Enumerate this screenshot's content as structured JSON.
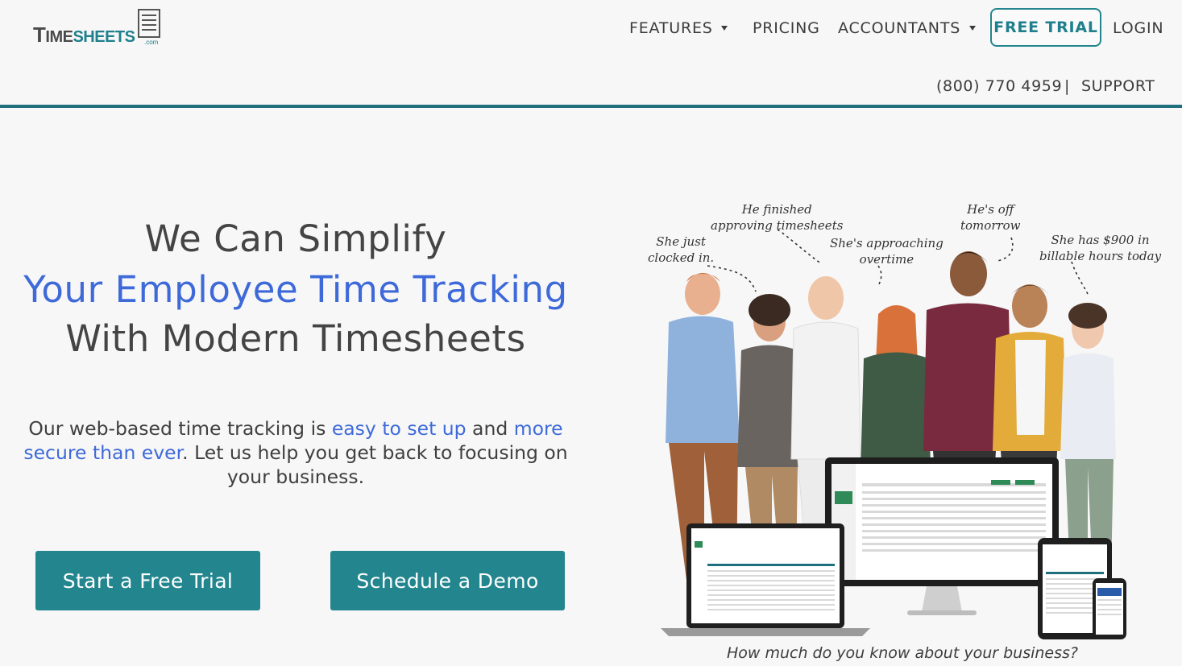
{
  "header": {
    "logo": {
      "text_main": "TIMESHEETS",
      "text_suffix": ".com"
    },
    "nav": {
      "features": "FEATURES",
      "pricing": "PRICING",
      "accountants": "ACCOUNTANTS",
      "free_trial": "FREE TRIAL",
      "login": "LOGIN"
    },
    "phone": "(800) 770 4959",
    "separator": "|",
    "support": "SUPPORT"
  },
  "hero": {
    "headline_1": "We Can Simplify",
    "headline_2": "Your Employee Time Tracking",
    "headline_3": "With Modern Timesheets",
    "blurb": {
      "part1": "Our web-based time tracking is ",
      "highlight1": "easy to set up",
      "part2": " and ",
      "highlight2": "more secure than ever",
      "part3": ". Let us help you get back to focusing on your business."
    },
    "cta_primary": "Start a Free Trial",
    "cta_secondary": "Schedule a Demo"
  },
  "illustration": {
    "notes": {
      "clocked_in": "She just\nclocked in.",
      "approving": "He finished\napproving timesheets",
      "overtime": "She's approaching\novertime",
      "off_tomorrow": "He's off\ntomorrow",
      "billable": "She has $900 in\nbillable hours today"
    },
    "caption": "How much do you know about your business?"
  },
  "colors": {
    "brand_teal": "#23868f",
    "accent_blue": "#3e6ad9",
    "header_rule": "#1f6f7d"
  }
}
